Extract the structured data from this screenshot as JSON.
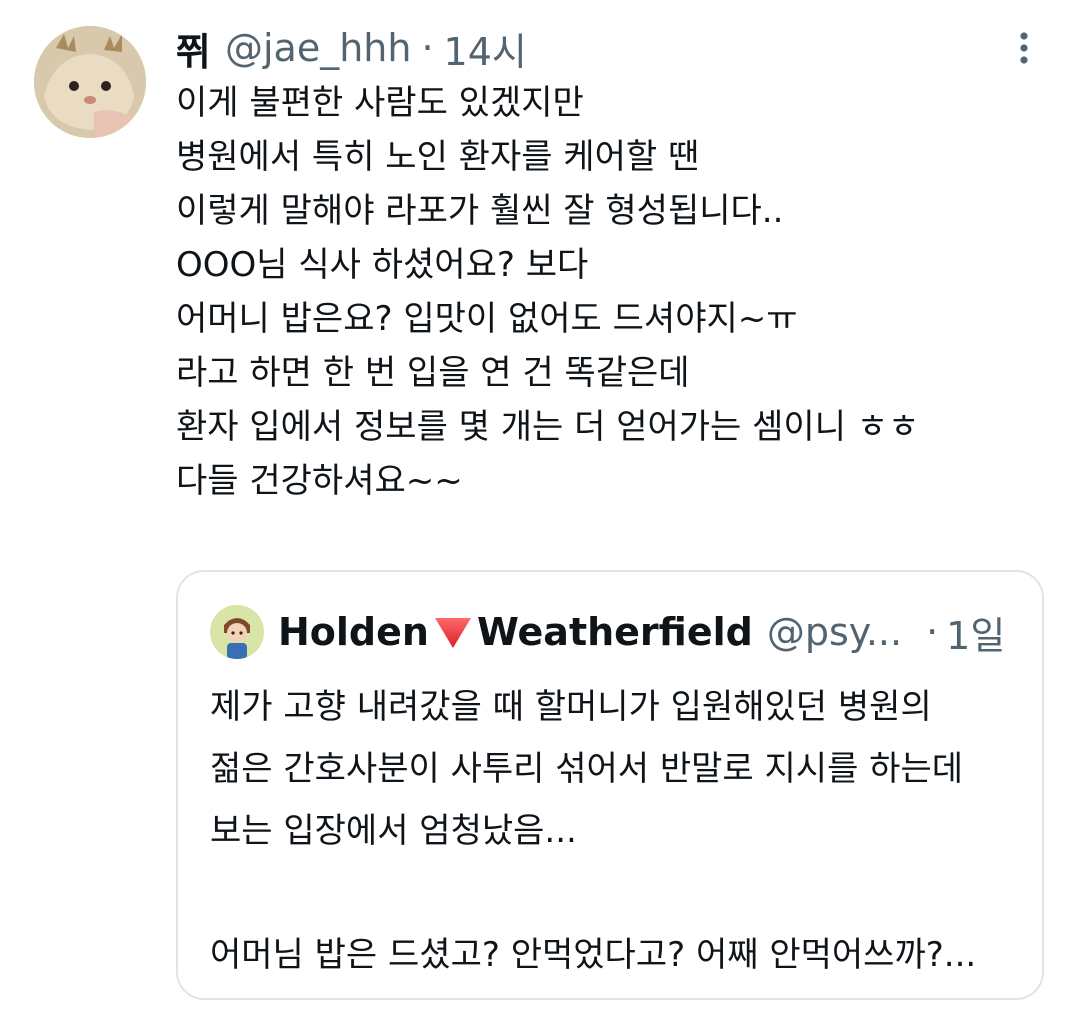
{
  "tweet": {
    "author_name": "쮜",
    "author_handle": "@jae_hhh",
    "separator": "·",
    "time": "14시",
    "lines": [
      "이게 불편한 사람도 있겠지만",
      "병원에서 특히 노인 환자를 케어할 땐",
      "이렇게 말해야 라포가 훨씬 잘 형성됩니다..",
      "OOO님 식사 하셨어요? 보다",
      "어머니 밥은요? 입맛이 없어도 드셔야지~ㅠ",
      "라고 하면 한 번 입을 연 건 똑같은데",
      "환자 입에서 정보를 몇 개는 더 얻어가는 셈이니 ㅎㅎ",
      "다들 건강하셔요~~"
    ]
  },
  "quoted": {
    "name_part1": "Holden",
    "name_emoji": "red-triangle-down",
    "name_part2": "Weatherfield",
    "handle": "@psy...",
    "separator": "·",
    "time": "1일",
    "lines": [
      "제가 고향 내려갔을 때 할머니가 입원해있던 병원의",
      "젊은 간호사분이 사투리 섞어서 반말로 지시를 하는데",
      "보는 입장에서 엄청났음...",
      "",
      "어머님 밥은 드셨고? 안먹었다고? 어째 안먹어쓰까?..."
    ]
  },
  "icons": {
    "more": "more-vertical-icon",
    "emoji_color": "#e0245e"
  }
}
